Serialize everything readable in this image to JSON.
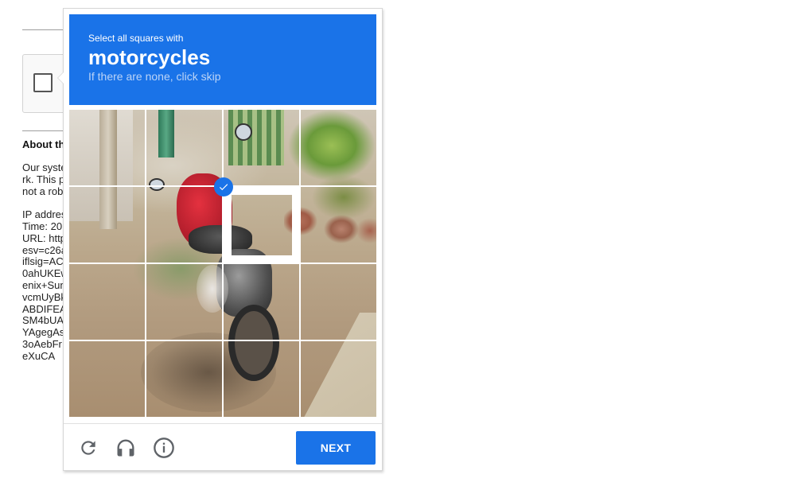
{
  "background_page": {
    "about_heading": "About th",
    "about_text": "Our syste\nrk. This p\nnot a rob\n\nIP addres\nTime: 20:\nURL: http\nesv=c26a\niflsig=AC\n0ahUKEw\nenix+Sum\nvcmUyBk\nABDIFEA\nSM4bUA\nYAgegAs\n3oAebFr\neXuCA"
  },
  "challenge": {
    "instruction": "Select all squares with",
    "target": "motorcycles",
    "hint": "If there are none, click skip",
    "colors": {
      "header_bg": "#1a73e8",
      "check_bg": "#1a73e8",
      "button_bg": "#1a73e8"
    },
    "grid": {
      "rows": 4,
      "cols": 4,
      "selected_tiles": [
        6
      ]
    },
    "footer": {
      "reload_icon": "reload-icon",
      "audio_icon": "headphones-icon",
      "info_icon": "info-icon",
      "next_label": "NEXT"
    }
  }
}
